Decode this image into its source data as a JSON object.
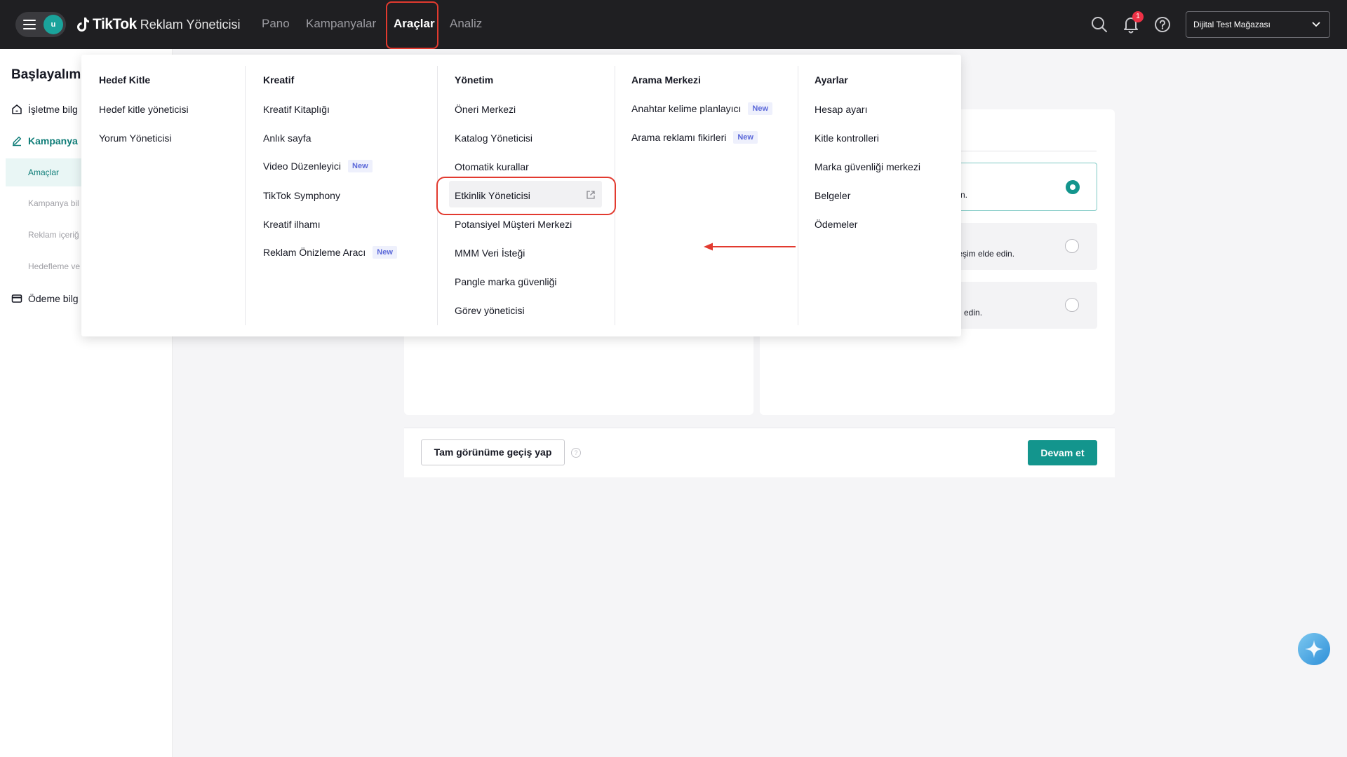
{
  "header": {
    "avatar_initial": "u",
    "logo_brand": "TikTok",
    "logo_product": "Reklam Yöneticisi",
    "nav": [
      {
        "label": "Pano"
      },
      {
        "label": "Kampanyalar"
      },
      {
        "label": "Araçlar",
        "active": true
      },
      {
        "label": "Analiz"
      }
    ],
    "notification_count": "1",
    "account_name": "Dijital Test Mağazası",
    "icons": [
      "search-icon",
      "bell-icon",
      "help-icon",
      "chevron-down-icon"
    ]
  },
  "sidebar": {
    "title": "Başlayalım",
    "items": [
      {
        "label": "İşletme bilg",
        "icon": "home-icon"
      },
      {
        "label": "Kampanya",
        "icon": "pencil-icon"
      },
      {
        "label": "Ödeme bilg",
        "icon": "card-icon"
      }
    ],
    "subitems": [
      {
        "label": "Amaçlar",
        "active": true
      },
      {
        "label": "Kampanya bil"
      },
      {
        "label": "Reklam içeriğ"
      },
      {
        "label": "Hedefleme ve"
      }
    ]
  },
  "main": {
    "options": [
      {
        "text": "n.",
        "selected": true
      },
      {
        "text": "kileşim elde edin.",
        "selected": false
      },
      {
        "text": "edin.",
        "selected": false
      }
    ],
    "toggle_view_button": "Tam görünüme geçiş yap",
    "continue_button": "Devam et"
  },
  "tools_menu": {
    "new_badge": "New",
    "columns": [
      {
        "heading": "Hedef Kitle",
        "items": [
          {
            "label": "Hedef kitle yöneticisi"
          },
          {
            "label": "Yorum Yöneticisi"
          }
        ]
      },
      {
        "heading": "Kreatif",
        "items": [
          {
            "label": "Kreatif Kitaplığı"
          },
          {
            "label": "Anlık sayfa"
          },
          {
            "label": "Video Düzenleyici",
            "new": true
          },
          {
            "label": "TikTok Symphony"
          },
          {
            "label": "Kreatif ilhamı"
          },
          {
            "label": "Reklam Önizleme Aracı",
            "new": true
          }
        ]
      },
      {
        "heading": "Yönetim",
        "items": [
          {
            "label": "Öneri Merkezi"
          },
          {
            "label": "Katalog Yöneticisi"
          },
          {
            "label": "Otomatik kurallar"
          },
          {
            "label": "Etkinlik Yöneticisi",
            "external": true,
            "highlighted": true
          },
          {
            "label": "Potansiyel Müşteri Merkezi"
          },
          {
            "label": "MMM Veri İsteği"
          },
          {
            "label": "Pangle marka güvenliği"
          },
          {
            "label": "Görev yöneticisi"
          }
        ]
      },
      {
        "heading": "Arama Merkezi",
        "items": [
          {
            "label": "Anahtar kelime planlayıcı",
            "new": true
          },
          {
            "label": "Arama reklamı fikirleri",
            "new": true
          }
        ]
      },
      {
        "heading": "Ayarlar",
        "items": [
          {
            "label": "Hesap ayarı"
          },
          {
            "label": "Kitle kontrolleri"
          },
          {
            "label": "Marka güvenliği merkezi"
          },
          {
            "label": "Belgeler"
          },
          {
            "label": "Ödemeler"
          }
        ]
      }
    ]
  },
  "colors": {
    "topbar": "#1f1f22",
    "accent": "#13958d",
    "highlight": "#e23a2f",
    "new_badge": "#5b68d9"
  }
}
